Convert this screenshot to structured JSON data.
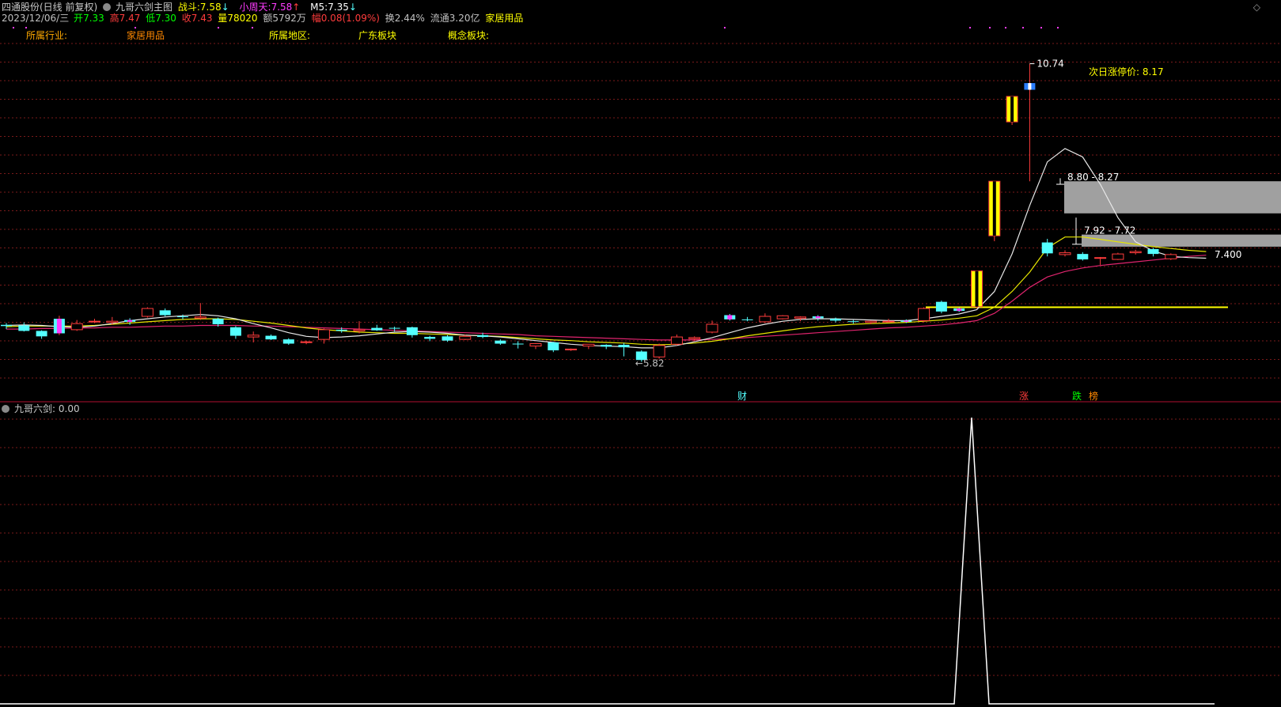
{
  "header": {
    "stock_title": "四通股份(日线 前复权)",
    "indicator_name": "九哥六剑主图",
    "zhandou_label": "战斗:",
    "zhandou_value": "7.58",
    "zhandou_arrow": "↓",
    "xiaozhoutian_label": "小周天:",
    "xiaozhoutian_value": "7.58",
    "xiaozhoutian_arrow": "↑",
    "m5_label": "M5:",
    "m5_value": "7.35",
    "m5_arrow": "↓",
    "date": "2023/12/06/三",
    "open_label": "开",
    "open_value": "7.33",
    "high_label": "高",
    "high_value": "7.47",
    "low_label": "低",
    "low_value": "7.30",
    "close_label": "收",
    "close_value": "7.43",
    "volume_label": "量",
    "volume_value": "78020",
    "amount_label": "额",
    "amount_value": "5792万",
    "change_label": "幅",
    "change_value": "0.08(1.09%)",
    "turnover_label": "换",
    "turnover_value": "2.44%",
    "float_label": "流通",
    "float_value": "3.20亿",
    "sector": "家居用品",
    "colors": {
      "up": "#ff3c3c",
      "down": "#54ffff",
      "label": "#ffff00",
      "pink": "#ff3cff",
      "green": "#00ff00"
    }
  },
  "info_bar": {
    "industry_label": "所属行业:",
    "industry_value": "家居用品",
    "region_label": "所属地区:",
    "region_value": "广东板块",
    "concept_label": "概念板块:"
  },
  "annotations": {
    "peak_label": "10.74",
    "low_label": "5.82",
    "next_limit_label": "次日涨停价: 8.17",
    "zone1_label": "8.80 - 8.27",
    "zone2_label": "7.92 - 7.72",
    "last_price_label": "7.400",
    "marker_cai": "财",
    "marker_zhang": "涨",
    "marker_die": "跌",
    "marker_bang": "榜"
  },
  "sub_panel": {
    "title": "九哥六剑",
    "value_label": ": 0.00"
  },
  "chart_data": {
    "type": "candlestick",
    "y_range_main": [
      5.2,
      11.4
    ],
    "candles": [
      {
        "o": 6.43,
        "h": 6.46,
        "l": 6.36,
        "c": 6.41
      },
      {
        "o": 6.42,
        "h": 6.47,
        "l": 6.32,
        "c": 6.33
      },
      {
        "o": 6.33,
        "h": 6.34,
        "l": 6.2,
        "c": 6.24
      },
      {
        "o": 6.29,
        "h": 6.58,
        "l": 6.26,
        "c": 6.53,
        "pink": true
      },
      {
        "o": 6.35,
        "h": 6.51,
        "l": 6.33,
        "c": 6.45
      },
      {
        "o": 6.48,
        "h": 6.53,
        "l": 6.46,
        "c": 6.49
      },
      {
        "o": 6.47,
        "h": 6.56,
        "l": 6.43,
        "c": 6.49
      },
      {
        "o": 6.51,
        "h": 6.54,
        "l": 6.43,
        "c": 6.48,
        "pink": true
      },
      {
        "o": 6.57,
        "h": 6.72,
        "l": 6.55,
        "c": 6.7
      },
      {
        "o": 6.67,
        "h": 6.7,
        "l": 6.57,
        "c": 6.59
      },
      {
        "o": 6.57,
        "h": 6.6,
        "l": 6.52,
        "c": 6.56
      },
      {
        "o": 6.54,
        "h": 6.79,
        "l": 6.51,
        "c": 6.56
      },
      {
        "o": 6.53,
        "h": 6.55,
        "l": 6.4,
        "c": 6.44
      },
      {
        "o": 6.39,
        "h": 6.41,
        "l": 6.2,
        "c": 6.25
      },
      {
        "o": 6.23,
        "h": 6.32,
        "l": 6.14,
        "c": 6.26
      },
      {
        "o": 6.25,
        "h": 6.27,
        "l": 6.18,
        "c": 6.19
      },
      {
        "o": 6.19,
        "h": 6.21,
        "l": 6.1,
        "c": 6.12
      },
      {
        "o": 6.15,
        "h": 6.17,
        "l": 6.11,
        "c": 6.15
      },
      {
        "o": 6.19,
        "h": 6.37,
        "l": 6.12,
        "c": 6.35
      },
      {
        "o": 6.35,
        "h": 6.39,
        "l": 6.3,
        "c": 6.33
      },
      {
        "o": 6.33,
        "h": 6.49,
        "l": 6.29,
        "c": 6.35
      },
      {
        "o": 6.38,
        "h": 6.43,
        "l": 6.33,
        "c": 6.34
      },
      {
        "o": 6.38,
        "h": 6.4,
        "l": 6.32,
        "c": 6.37
      },
      {
        "o": 6.39,
        "h": 6.4,
        "l": 6.22,
        "c": 6.26
      },
      {
        "o": 6.23,
        "h": 6.25,
        "l": 6.16,
        "c": 6.2
      },
      {
        "o": 6.24,
        "h": 6.26,
        "l": 6.15,
        "c": 6.17
      },
      {
        "o": 6.19,
        "h": 6.27,
        "l": 6.18,
        "c": 6.24
      },
      {
        "o": 6.26,
        "h": 6.3,
        "l": 6.21,
        "c": 6.23
      },
      {
        "o": 6.17,
        "h": 6.19,
        "l": 6.1,
        "c": 6.12
      },
      {
        "o": 6.12,
        "h": 6.16,
        "l": 6.04,
        "c": 6.11
      },
      {
        "o": 6.08,
        "h": 6.13,
        "l": 6.03,
        "c": 6.12
      },
      {
        "o": 6.14,
        "h": 6.15,
        "l": 5.98,
        "c": 6.01
      },
      {
        "o": 6.02,
        "h": 6.04,
        "l": 6.0,
        "c": 6.03
      },
      {
        "o": 6.08,
        "h": 6.1,
        "l": 6.03,
        "c": 6.11
      },
      {
        "o": 6.1,
        "h": 6.11,
        "l": 6.03,
        "c": 6.07
      },
      {
        "o": 6.1,
        "h": 6.13,
        "l": 5.91,
        "c": 6.06
      },
      {
        "o": 5.99,
        "h": 6.01,
        "l": 5.82,
        "c": 5.85
      },
      {
        "o": 5.9,
        "h": 6.12,
        "l": 5.87,
        "c": 6.09
      },
      {
        "o": 6.11,
        "h": 6.27,
        "l": 6.09,
        "c": 6.23
      },
      {
        "o": 6.2,
        "h": 6.24,
        "l": 6.16,
        "c": 6.22
      },
      {
        "o": 6.31,
        "h": 6.5,
        "l": 6.29,
        "c": 6.44
      },
      {
        "o": 6.59,
        "h": 6.61,
        "l": 6.5,
        "c": 6.52,
        "pink": true
      },
      {
        "o": 6.52,
        "h": 6.56,
        "l": 6.49,
        "c": 6.51
      },
      {
        "o": 6.48,
        "h": 6.62,
        "l": 6.46,
        "c": 6.57
      },
      {
        "o": 6.53,
        "h": 6.59,
        "l": 6.52,
        "c": 6.58
      },
      {
        "o": 6.54,
        "h": 6.57,
        "l": 6.49,
        "c": 6.56
      },
      {
        "o": 6.57,
        "h": 6.59,
        "l": 6.5,
        "c": 6.54,
        "pink": true
      },
      {
        "o": 6.53,
        "h": 6.55,
        "l": 6.47,
        "c": 6.5
      },
      {
        "o": 6.49,
        "h": 6.51,
        "l": 6.45,
        "c": 6.48
      },
      {
        "o": 6.47,
        "h": 6.5,
        "l": 6.44,
        "c": 6.49
      },
      {
        "o": 6.48,
        "h": 6.53,
        "l": 6.47,
        "c": 6.49
      },
      {
        "o": 6.5,
        "h": 6.52,
        "l": 6.46,
        "c": 6.48,
        "pink": true
      },
      {
        "o": 6.5,
        "h": 6.72,
        "l": 6.47,
        "c": 6.7
      },
      {
        "o": 6.81,
        "h": 6.83,
        "l": 6.62,
        "c": 6.65
      },
      {
        "o": 6.7,
        "h": 6.72,
        "l": 6.64,
        "c": 6.66,
        "pink": true
      },
      {
        "o": 6.73,
        "h": 7.26,
        "l": 6.7,
        "c": 7.32,
        "yellow": true
      },
      {
        "o": 7.9,
        "h": 8.12,
        "l": 7.81,
        "c": 8.8,
        "yellow": true
      },
      {
        "o": 9.78,
        "h": 10.09,
        "l": 9.73,
        "c": 10.2,
        "yellow": true
      },
      {
        "o": 10.31,
        "h": 10.74,
        "l": 8.8,
        "c": 10.42,
        "blue": true
      },
      {
        "o": 7.79,
        "h": 7.85,
        "l": 7.56,
        "c": 7.61
      },
      {
        "o": 7.59,
        "h": 7.66,
        "l": 7.56,
        "c": 7.62
      },
      {
        "o": 7.6,
        "h": 7.63,
        "l": 7.49,
        "c": 7.51
      },
      {
        "o": 7.53,
        "h": 7.55,
        "l": 7.42,
        "c": 7.54
      },
      {
        "o": 7.51,
        "h": 7.62,
        "l": 7.5,
        "c": 7.6
      },
      {
        "o": 7.62,
        "h": 7.67,
        "l": 7.59,
        "c": 7.64
      },
      {
        "o": 7.68,
        "h": 7.7,
        "l": 7.56,
        "c": 7.6
      },
      {
        "o": 7.52,
        "h": 7.61,
        "l": 7.5,
        "c": 7.59
      }
    ],
    "ma_white": [
      6.42,
      6.43,
      6.42,
      6.4,
      6.39,
      6.41,
      6.45,
      6.5,
      6.53,
      6.56,
      6.58,
      6.6,
      6.58,
      6.53,
      6.45,
      6.38,
      6.3,
      6.24,
      6.22,
      6.23,
      6.25,
      6.28,
      6.31,
      6.32,
      6.31,
      6.29,
      6.26,
      6.25,
      6.23,
      6.2,
      6.17,
      6.14,
      6.11,
      6.09,
      6.08,
      6.07,
      6.05,
      6.05,
      6.09,
      6.15,
      6.22,
      6.3,
      6.38,
      6.44,
      6.49,
      6.52,
      6.53,
      6.53,
      6.52,
      6.51,
      6.5,
      6.5,
      6.53,
      6.57,
      6.61,
      6.68,
      6.98,
      7.6,
      8.4,
      9.12,
      9.34,
      9.2,
      8.75,
      8.2,
      7.8,
      7.65,
      7.56,
      7.54,
      7.53
    ],
    "ma_yellow": [
      6.4,
      6.41,
      6.41,
      6.41,
      6.41,
      6.42,
      6.44,
      6.46,
      6.48,
      6.5,
      6.52,
      6.53,
      6.53,
      6.52,
      6.49,
      6.46,
      6.42,
      6.38,
      6.35,
      6.33,
      6.31,
      6.3,
      6.29,
      6.29,
      6.28,
      6.27,
      6.26,
      6.25,
      6.24,
      6.22,
      6.2,
      6.18,
      6.17,
      6.15,
      6.14,
      6.13,
      6.11,
      6.1,
      6.11,
      6.13,
      6.16,
      6.2,
      6.25,
      6.29,
      6.33,
      6.37,
      6.4,
      6.42,
      6.44,
      6.45,
      6.46,
      6.47,
      6.49,
      6.51,
      6.54,
      6.58,
      6.72,
      6.98,
      7.3,
      7.7,
      7.88,
      7.88,
      7.84,
      7.8,
      7.76,
      7.72,
      7.69,
      7.66,
      7.64
    ],
    "ma_pink": [
      6.36,
      6.36,
      6.37,
      6.37,
      6.38,
      6.38,
      6.39,
      6.39,
      6.4,
      6.41,
      6.41,
      6.42,
      6.42,
      6.42,
      6.41,
      6.41,
      6.4,
      6.39,
      6.38,
      6.37,
      6.36,
      6.35,
      6.34,
      6.33,
      6.32,
      6.31,
      6.3,
      6.29,
      6.28,
      6.27,
      6.25,
      6.24,
      6.23,
      6.22,
      6.21,
      6.2,
      6.19,
      6.18,
      6.18,
      6.18,
      6.19,
      6.2,
      6.22,
      6.24,
      6.26,
      6.28,
      6.3,
      6.32,
      6.34,
      6.36,
      6.38,
      6.39,
      6.41,
      6.43,
      6.46,
      6.5,
      6.62,
      6.82,
      7.05,
      7.22,
      7.31,
      7.37,
      7.41,
      7.44,
      7.47,
      7.5,
      7.53,
      7.56,
      7.58
    ],
    "indicator": {
      "peak_value": 1.0,
      "peak_index": 55,
      "values_range": [
        0,
        1
      ]
    }
  }
}
